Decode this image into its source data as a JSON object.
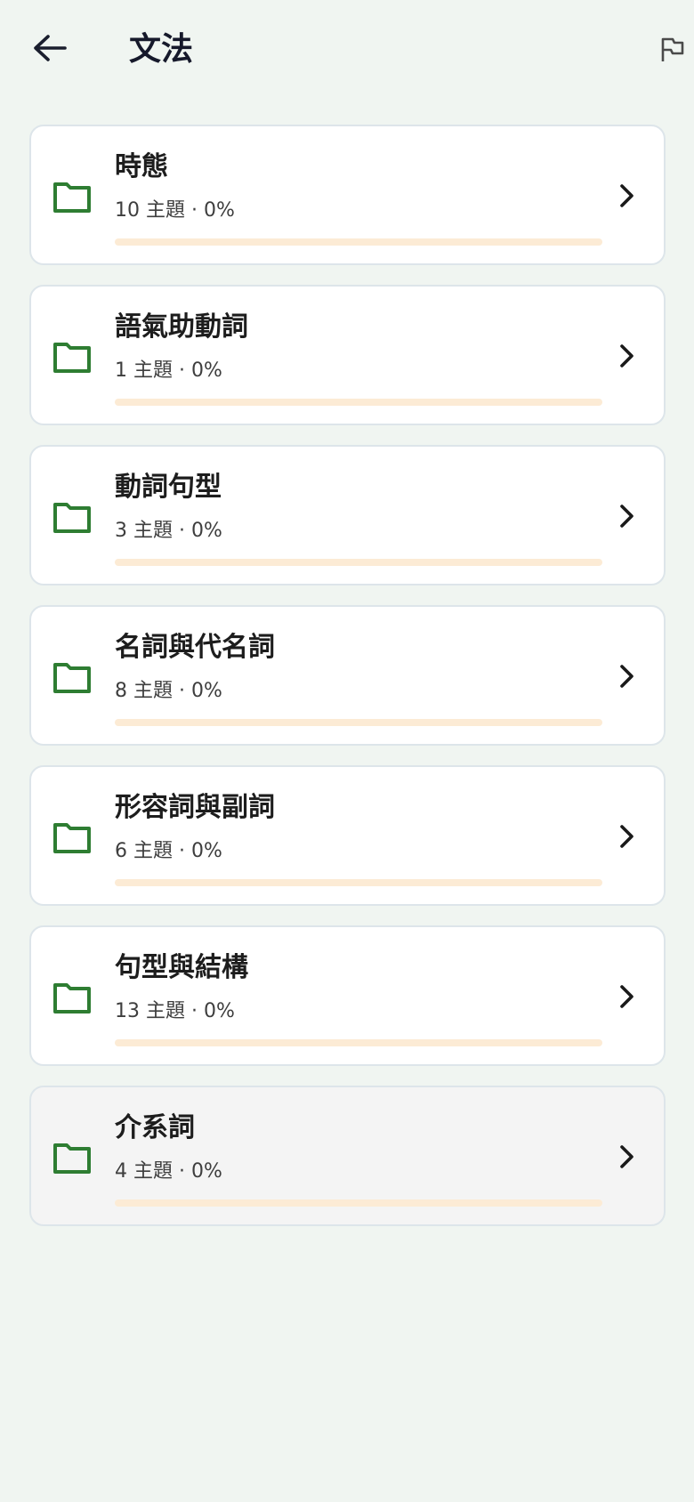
{
  "header": {
    "title": "文法",
    "back_icon": "arrow-left-icon",
    "flag_icon": "flag-icon"
  },
  "categories": [
    {
      "title": "時態",
      "subtitle": "10 主題 · 0%",
      "progress": 0
    },
    {
      "title": "語氣助動詞",
      "subtitle": "1 主題 · 0%",
      "progress": 0
    },
    {
      "title": "動詞句型",
      "subtitle": "3 主題 · 0%",
      "progress": 0
    },
    {
      "title": "名詞與代名詞",
      "subtitle": "8 主題 · 0%",
      "progress": 0
    },
    {
      "title": "形容詞與副詞",
      "subtitle": "6 主題 · 0%",
      "progress": 0
    },
    {
      "title": "句型與結構",
      "subtitle": "13 主題 · 0%",
      "progress": 0
    },
    {
      "title": "介系詞",
      "subtitle": "4 主題 · 0%",
      "progress": 0
    }
  ],
  "colors": {
    "background": "#f0f5f1",
    "folder_icon": "#2e7d32",
    "progress_track": "#fcebd5",
    "title_text": "#16192b"
  }
}
